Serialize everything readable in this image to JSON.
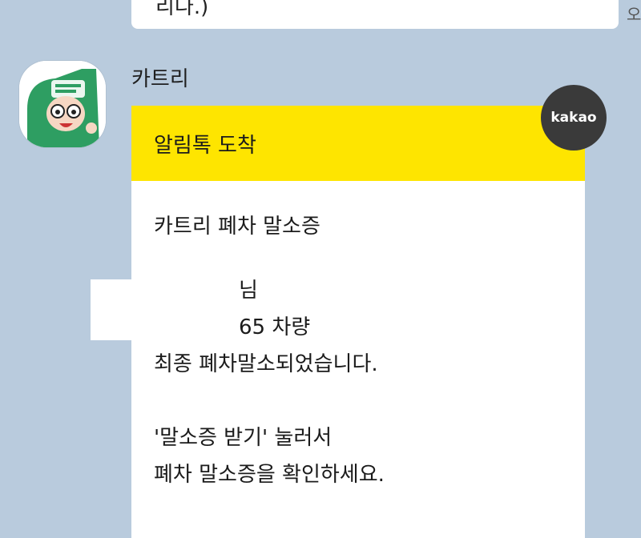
{
  "previous_message": {
    "text": "리다.)",
    "side_mark": "오"
  },
  "sender": {
    "name": "카트리"
  },
  "card": {
    "header": "알림톡 도착",
    "title": "카트리 폐차 말소증",
    "name_suffix": "님",
    "vehicle": "65 차량",
    "status": "최종 폐차말소되었습니다.",
    "instruction": "'말소증 받기' 눌러서",
    "instruction2": "폐차 말소증을 확인하세요."
  },
  "badge": {
    "label": "kakao"
  },
  "colors": {
    "background": "#b9cbdd",
    "header": "#fee500",
    "badge": "#3a3a3a",
    "avatar_green": "#2e9e62"
  }
}
